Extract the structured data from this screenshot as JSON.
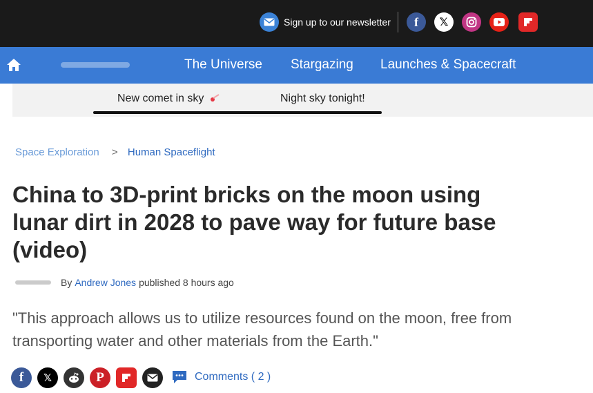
{
  "topbar": {
    "newsletter_label": "Sign up to our newsletter",
    "social": [
      "facebook",
      "x",
      "instagram",
      "youtube",
      "flipboard"
    ]
  },
  "nav": {
    "items": [
      "The Universe",
      "Stargazing",
      "Launches & Spacecraft"
    ]
  },
  "subnav": {
    "items": [
      "New comet in sky",
      "Night sky tonight!"
    ]
  },
  "breadcrumb": {
    "items": [
      "Space Exploration",
      "Human Spaceflight"
    ],
    "separator": ">"
  },
  "article": {
    "title": "China to 3D-print bricks on the moon using lunar dirt in 2028 to pave way for future base (video)",
    "byline_prefix": "By",
    "author": "Andrew Jones",
    "published": "published 8 hours ago",
    "quote": "\"This approach allows us to utilize resources found on the moon, free from transporting water and other materials from the Earth.\""
  },
  "share": {
    "buttons": [
      "facebook",
      "x",
      "reddit",
      "pinterest",
      "flipboard",
      "email"
    ],
    "comments_label": "Comments ( 2 )"
  },
  "colors": {
    "topbar": "#1a1a1a",
    "nav": "#3a7bd5",
    "link": "#2f6ac0",
    "facebook": "#3b5998",
    "x": "#000000",
    "instagram": "#c13584",
    "youtube": "#e62117",
    "flipboard": "#e12828",
    "reddit": "#333333",
    "pinterest": "#cb2027",
    "email": "#222222"
  }
}
